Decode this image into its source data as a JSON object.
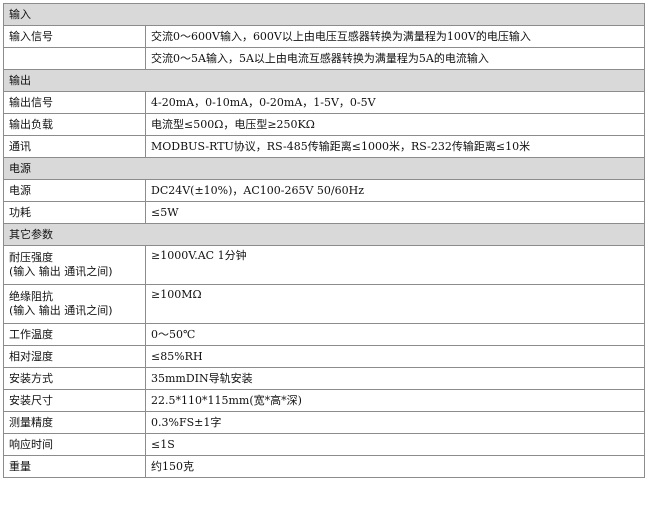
{
  "sections": {
    "input": {
      "title": "输入",
      "rows": [
        {
          "label": "输入信号",
          "value": "交流0～600V输入，600V以上由电压互感器转换为满量程为100V的电压输入"
        },
        {
          "label": "",
          "value": "交流0～5A输入，5A以上由电流互感器转换为满量程为5A的电流输入"
        }
      ]
    },
    "output": {
      "title": "输出",
      "rows": [
        {
          "label": "输出信号",
          "value": "4-20mA，0-10mA，0-20mA，1-5V，0-5V"
        },
        {
          "label": "输出负载",
          "value": "电流型≤500Ω，电压型≥250KΩ"
        },
        {
          "label": "通讯",
          "value": "MODBUS-RTU协议，RS-485传输距离≤1000米，RS-232传输距离≤10米"
        }
      ]
    },
    "power": {
      "title": "电源",
      "rows": [
        {
          "label": "电源",
          "value": "DC24V(±10%)，AC100-265V 50/60Hz"
        },
        {
          "label": "功耗",
          "value": "≤5W"
        }
      ]
    },
    "other": {
      "title": "其它参数",
      "rows": [
        {
          "label": "耐压强度",
          "sublabel": "(输入 输出 通讯之间)",
          "value": "≥1000V.AC 1分钟"
        },
        {
          "label": "绝缘阻抗",
          "sublabel": "(输入 输出 通讯之间)",
          "value": "≥100MΩ"
        },
        {
          "label": "工作温度",
          "value": "0～50℃"
        },
        {
          "label": "相对湿度",
          "value": "≤85%RH"
        },
        {
          "label": "安装方式",
          "value": "35mmDIN导轨安装"
        },
        {
          "label": "安装尺寸",
          "value": "22.5*110*115mm(宽*高*深)"
        },
        {
          "label": "测量精度",
          "value": "0.3%FS±1字"
        },
        {
          "label": "响应时间",
          "value": "≤1S"
        },
        {
          "label": "重量",
          "value": "约150克"
        }
      ]
    }
  }
}
